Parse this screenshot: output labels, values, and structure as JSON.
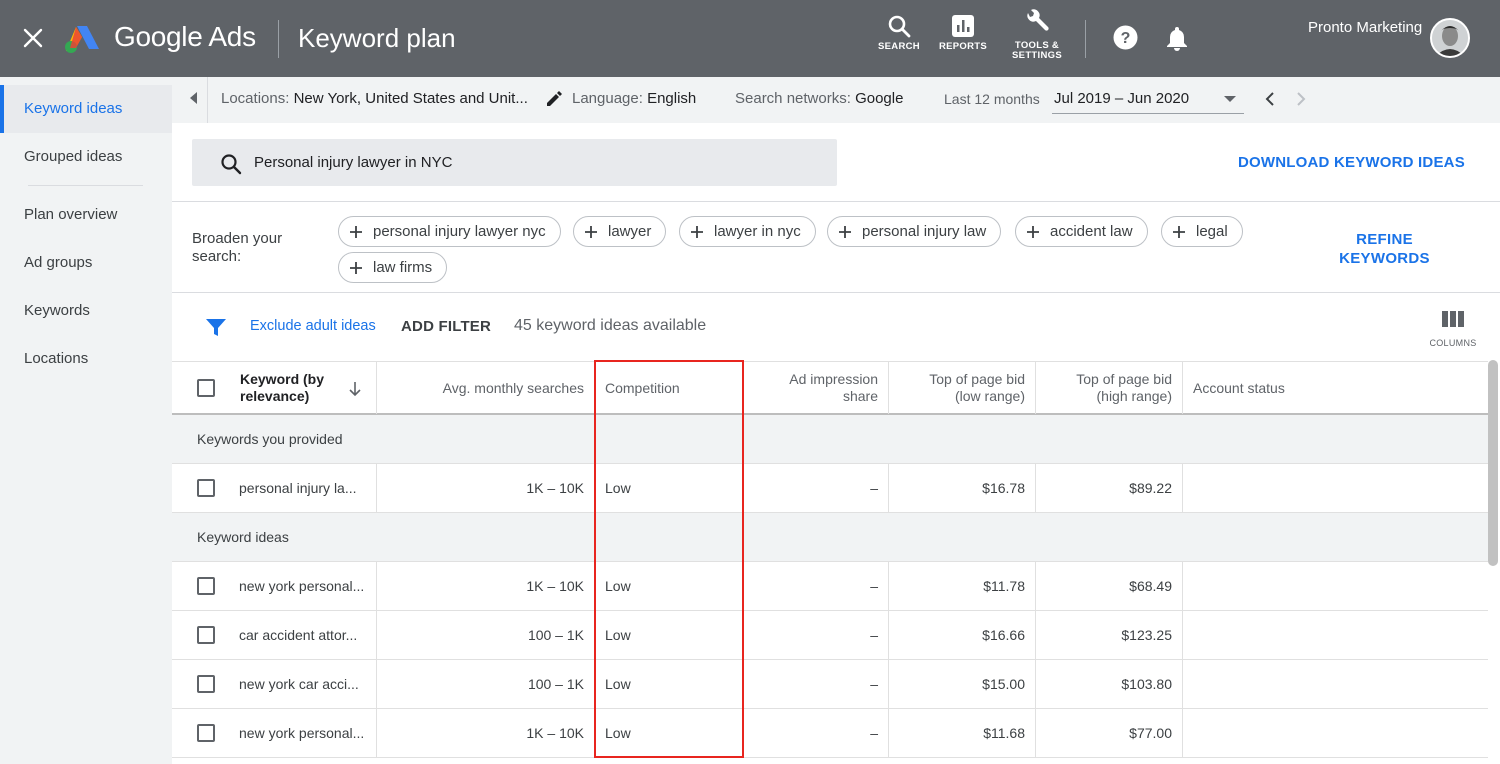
{
  "header": {
    "brand": "Google Ads",
    "page_title": "Keyword plan",
    "tools": [
      {
        "label": "SEARCH",
        "icon": "search-icon"
      },
      {
        "label": "REPORTS",
        "icon": "reports-icon"
      },
      {
        "label": "TOOLS &",
        "label2": "SETTINGS",
        "icon": "wrench-icon"
      }
    ],
    "account_name": "Pronto Marketing"
  },
  "sidebar": {
    "items": [
      {
        "label": "Keyword ideas",
        "active": true
      },
      {
        "label": "Grouped ideas"
      },
      {
        "label": "Plan overview"
      },
      {
        "label": "Ad groups"
      },
      {
        "label": "Keywords"
      },
      {
        "label": "Locations"
      }
    ]
  },
  "settings": {
    "locations_key": "Locations:",
    "locations_value": "New York, United States and Unit...",
    "language_key": "Language:",
    "language_value": "English",
    "networks_key": "Search networks:",
    "networks_value": "Google",
    "period_key": "Last 12 months",
    "period_value": "Jul 2019 – Jun 2020"
  },
  "search": {
    "query": "Personal injury lawyer in NYC",
    "download_label": "DOWNLOAD KEYWORD IDEAS"
  },
  "broaden": {
    "label": "Broaden your search:",
    "chips": [
      "personal injury lawyer nyc",
      "lawyer",
      "lawyer in nyc",
      "personal injury law",
      "accident law",
      "legal",
      "law firms"
    ],
    "refine_line1": "REFINE",
    "refine_line2": "KEYWORDS"
  },
  "filters": {
    "exclude_label": "Exclude adult ideas",
    "add_filter_label": "ADD FILTER",
    "count_text": "45 keyword ideas available",
    "columns_label": "COLUMNS"
  },
  "table": {
    "headers": {
      "keyword": "Keyword (by relevance)",
      "searches": "Avg. monthly searches",
      "competition": "Competition",
      "impression": "Ad impression share",
      "bid_low": "Top of page bid (low range)",
      "bid_high": "Top of page bid (high range)",
      "status": "Account status"
    },
    "group_provided": "Keywords you provided",
    "provided_rows": [
      {
        "keyword": "personal injury la...",
        "searches": "1K – 10K",
        "competition": "Low",
        "impression": "–",
        "bid_low": "$16.78",
        "bid_high": "$89.22",
        "status": ""
      }
    ],
    "group_ideas": "Keyword ideas",
    "idea_rows": [
      {
        "keyword": "new york personal...",
        "searches": "1K – 10K",
        "competition": "Low",
        "impression": "–",
        "bid_low": "$11.78",
        "bid_high": "$68.49",
        "status": ""
      },
      {
        "keyword": "car accident attor...",
        "searches": "100 – 1K",
        "competition": "Low",
        "impression": "–",
        "bid_low": "$16.66",
        "bid_high": "$123.25",
        "status": ""
      },
      {
        "keyword": "new york car acci...",
        "searches": "100 – 1K",
        "competition": "Low",
        "impression": "–",
        "bid_low": "$15.00",
        "bid_high": "$103.80",
        "status": ""
      },
      {
        "keyword": "new york personal...",
        "searches": "1K – 10K",
        "competition": "Low",
        "impression": "–",
        "bid_low": "$11.68",
        "bid_high": "$77.00",
        "status": ""
      }
    ]
  },
  "colors": {
    "topbar": "#5f6368",
    "accent": "#1a73e8",
    "highlight": "#e8251f"
  }
}
